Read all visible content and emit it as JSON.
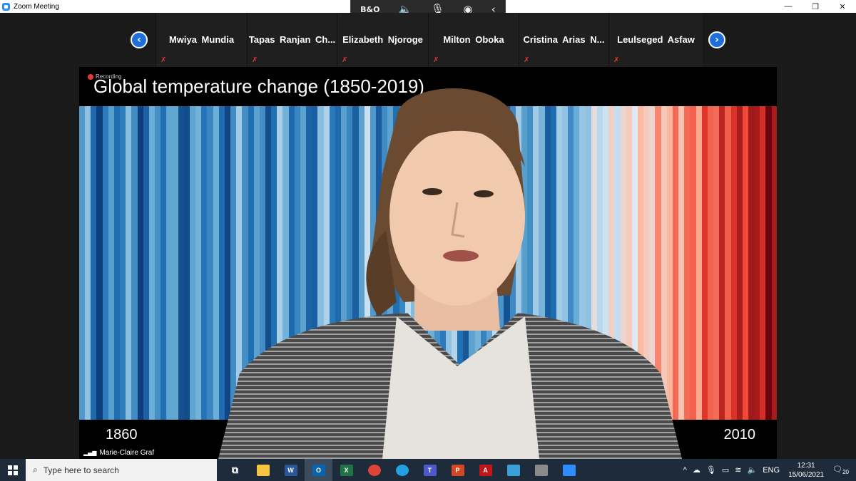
{
  "window": {
    "title": "Zoom Meeting",
    "controls": [
      "—",
      "❐",
      "✕"
    ]
  },
  "float_toolbar": {
    "items": [
      "B&O",
      "🔈",
      "🎙",
      "◉",
      "‹"
    ]
  },
  "participants": [
    {
      "name": "Mwiya Mundia"
    },
    {
      "name": "Tapas  Ranjan  Ch..."
    },
    {
      "name": "Elizabeth Njoroge"
    },
    {
      "name": "Milton Oboka"
    },
    {
      "name": "Cristina  Arias  N..."
    },
    {
      "name": "Leulseged Asfaw"
    }
  ],
  "nav": {
    "prev": "‹",
    "next": "›"
  },
  "video": {
    "recording_label": "Recording",
    "title": "Global temperature change (1850-2019)",
    "year_left": "1860",
    "year_right": "2010",
    "speaker_name": "Marie-Claire Graf",
    "signal_icon": "▂▄▆"
  },
  "taskbar": {
    "search_placeholder": "Type here to search",
    "apps": [
      {
        "name": "task-view",
        "label": "⧉",
        "color": "transparent"
      },
      {
        "name": "file-explorer",
        "label": "",
        "color": "#f6c443"
      },
      {
        "name": "word",
        "label": "W",
        "color": "#2b579a"
      },
      {
        "name": "outlook",
        "label": "O",
        "color": "#0a64ad"
      },
      {
        "name": "excel",
        "label": "X",
        "color": "#217346"
      },
      {
        "name": "chrome",
        "label": "",
        "color": "#db4437"
      },
      {
        "name": "edge",
        "label": "",
        "color": "#1fa1e2"
      },
      {
        "name": "teams",
        "label": "T",
        "color": "#5059c9"
      },
      {
        "name": "powerpoint",
        "label": "P",
        "color": "#d24726"
      },
      {
        "name": "acrobat",
        "label": "A",
        "color": "#c3161b"
      },
      {
        "name": "photos",
        "label": "",
        "color": "#3aa0d8"
      },
      {
        "name": "paint",
        "label": "",
        "color": "#8a8a8a"
      },
      {
        "name": "zoom",
        "label": "",
        "color": "#2d8cff"
      }
    ],
    "tray": {
      "chevron": "^",
      "language": "ENG",
      "time": "12:31",
      "date": "15/06/2021",
      "notifications": "20"
    }
  },
  "colors": {
    "accent": "#2d8cff",
    "nav_button": "#1e6fdc",
    "muted": "#e53935"
  }
}
